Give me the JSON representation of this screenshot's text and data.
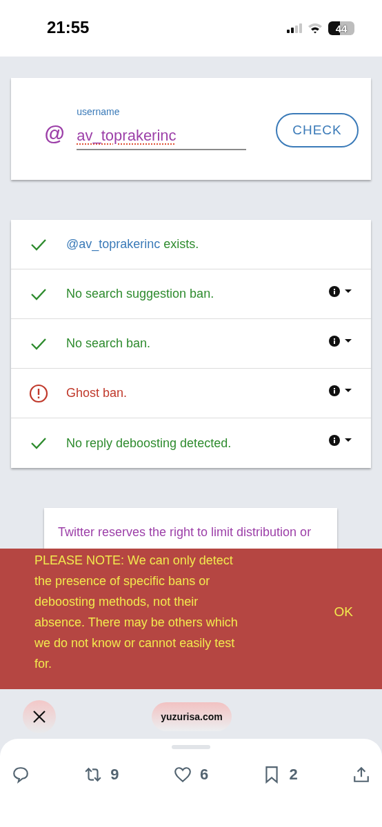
{
  "status_bar": {
    "time": "21:55",
    "battery": "44"
  },
  "username_form": {
    "label": "username",
    "prefix": "@",
    "value": "av_toprakerinc",
    "button": "CHECK"
  },
  "results": [
    {
      "kind": "ok",
      "handle": "@av_toprakerinc",
      "text": "exists."
    },
    {
      "kind": "ok",
      "text": "No search suggestion ban.",
      "has_info": true
    },
    {
      "kind": "ok",
      "text": "No search ban.",
      "has_info": true
    },
    {
      "kind": "ban",
      "text": "Ghost ban.",
      "has_info": true
    },
    {
      "kind": "ok",
      "text": "No reply deboosting detected.",
      "has_info": true
    }
  ],
  "notice_card": {
    "text": "Twitter reserves the right to limit distribution or"
  },
  "banner": {
    "text": "PLEASE NOTE: We can only detect the presence of specific bans or deboosting methods, not their absence. There may be others which we do not know or cannot easily test for.",
    "button": "OK"
  },
  "browser_overlay": {
    "url": "yuzurisa.com"
  },
  "actions": [
    {
      "kind": "reply"
    },
    {
      "kind": "retweet",
      "count": "9"
    },
    {
      "kind": "like",
      "count": "6"
    },
    {
      "kind": "bookmark",
      "count": "2"
    },
    {
      "kind": "share"
    }
  ]
}
